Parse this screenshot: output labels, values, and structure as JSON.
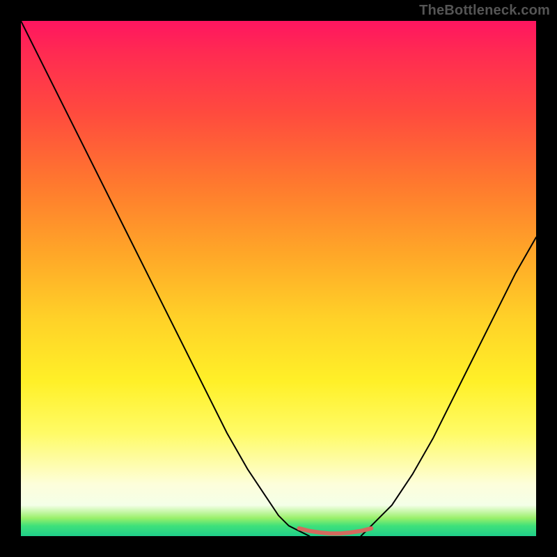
{
  "watermark": "TheBottleneck.com",
  "chart_data": {
    "type": "line",
    "title": "",
    "xlabel": "",
    "ylabel": "",
    "xlim": [
      0,
      100
    ],
    "ylim": [
      0,
      100
    ],
    "legend": false,
    "grid": false,
    "background_gradient": {
      "direction": "vertical",
      "stops": [
        {
          "at": 0.0,
          "color": "#ff1560"
        },
        {
          "at": 0.18,
          "color": "#ff4b3e"
        },
        {
          "at": 0.45,
          "color": "#ffa628"
        },
        {
          "at": 0.7,
          "color": "#fff028"
        },
        {
          "at": 0.9,
          "color": "#fdfedb"
        },
        {
          "at": 0.97,
          "color": "#5be37a"
        },
        {
          "at": 1.0,
          "color": "#1fcf8a"
        }
      ]
    },
    "series": [
      {
        "name": "left-branch",
        "stroke": "#000000",
        "x": [
          0,
          4,
          8,
          12,
          16,
          20,
          24,
          28,
          32,
          36,
          40,
          44,
          48,
          50,
          52,
          54,
          56
        ],
        "y": [
          100,
          92,
          84,
          76,
          68,
          60,
          52,
          44,
          36,
          28,
          20,
          13,
          7,
          4,
          2,
          1,
          0
        ]
      },
      {
        "name": "valley-flat",
        "stroke": "#d46a5e",
        "x": [
          54,
          56,
          58,
          60,
          62,
          64,
          66,
          68
        ],
        "y": [
          1.5,
          1.0,
          0.7,
          0.5,
          0.5,
          0.7,
          1.0,
          1.5
        ]
      },
      {
        "name": "right-branch",
        "stroke": "#000000",
        "x": [
          66,
          68,
          72,
          76,
          80,
          84,
          88,
          92,
          96,
          100
        ],
        "y": [
          0,
          2,
          6,
          12,
          19,
          27,
          35,
          43,
          51,
          58
        ]
      }
    ]
  }
}
